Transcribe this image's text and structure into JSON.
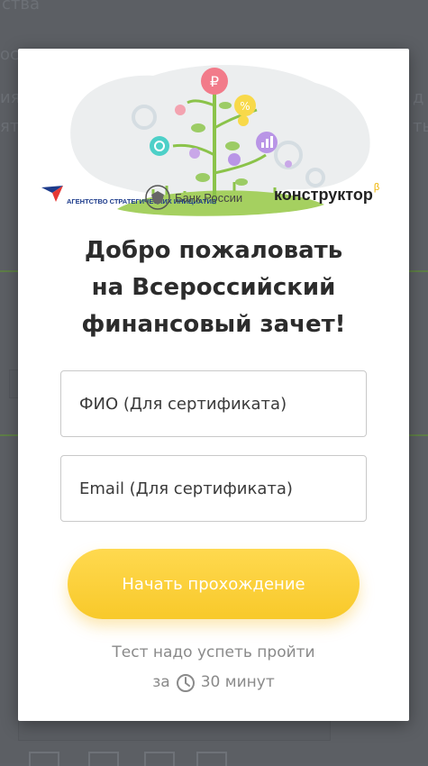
{
  "background": {
    "top_text_fragments": [
      "ства",
      "ос",
      "ия",
      "ято"
    ],
    "right_text_fragments": [
      "д",
      "ть"
    ]
  },
  "modal": {
    "logos": {
      "asi_label": "АГЕНТСТВО СТРАТЕГИЧЕСКИХ ИНИЦИАТИВ",
      "cbr_label": "Банк России",
      "konstruktor_label": "конструктор",
      "konstruktor_beta": "β"
    },
    "title_lines": [
      "Добро пожаловать",
      "на Всероссийский",
      "финансовый зачет!"
    ],
    "form": {
      "name_placeholder": "ФИО (Для сертификата)",
      "email_placeholder": "Email (Для сертификата)",
      "start_label": "Начать прохождение"
    },
    "note": {
      "line1": "Тест надо успеть пройти",
      "prefix": "за",
      "duration": "30 минут"
    }
  },
  "colors": {
    "accent": "#f8c92a",
    "ruble_pin": "#f27b8a",
    "green": "#8bc34a",
    "title": "#2c2c2c",
    "muted": "#8a8a8a"
  },
  "icons": [
    "ruble-icon",
    "percent-icon",
    "chart-icon",
    "refresh-icon",
    "gear-icon",
    "clock-icon"
  ]
}
